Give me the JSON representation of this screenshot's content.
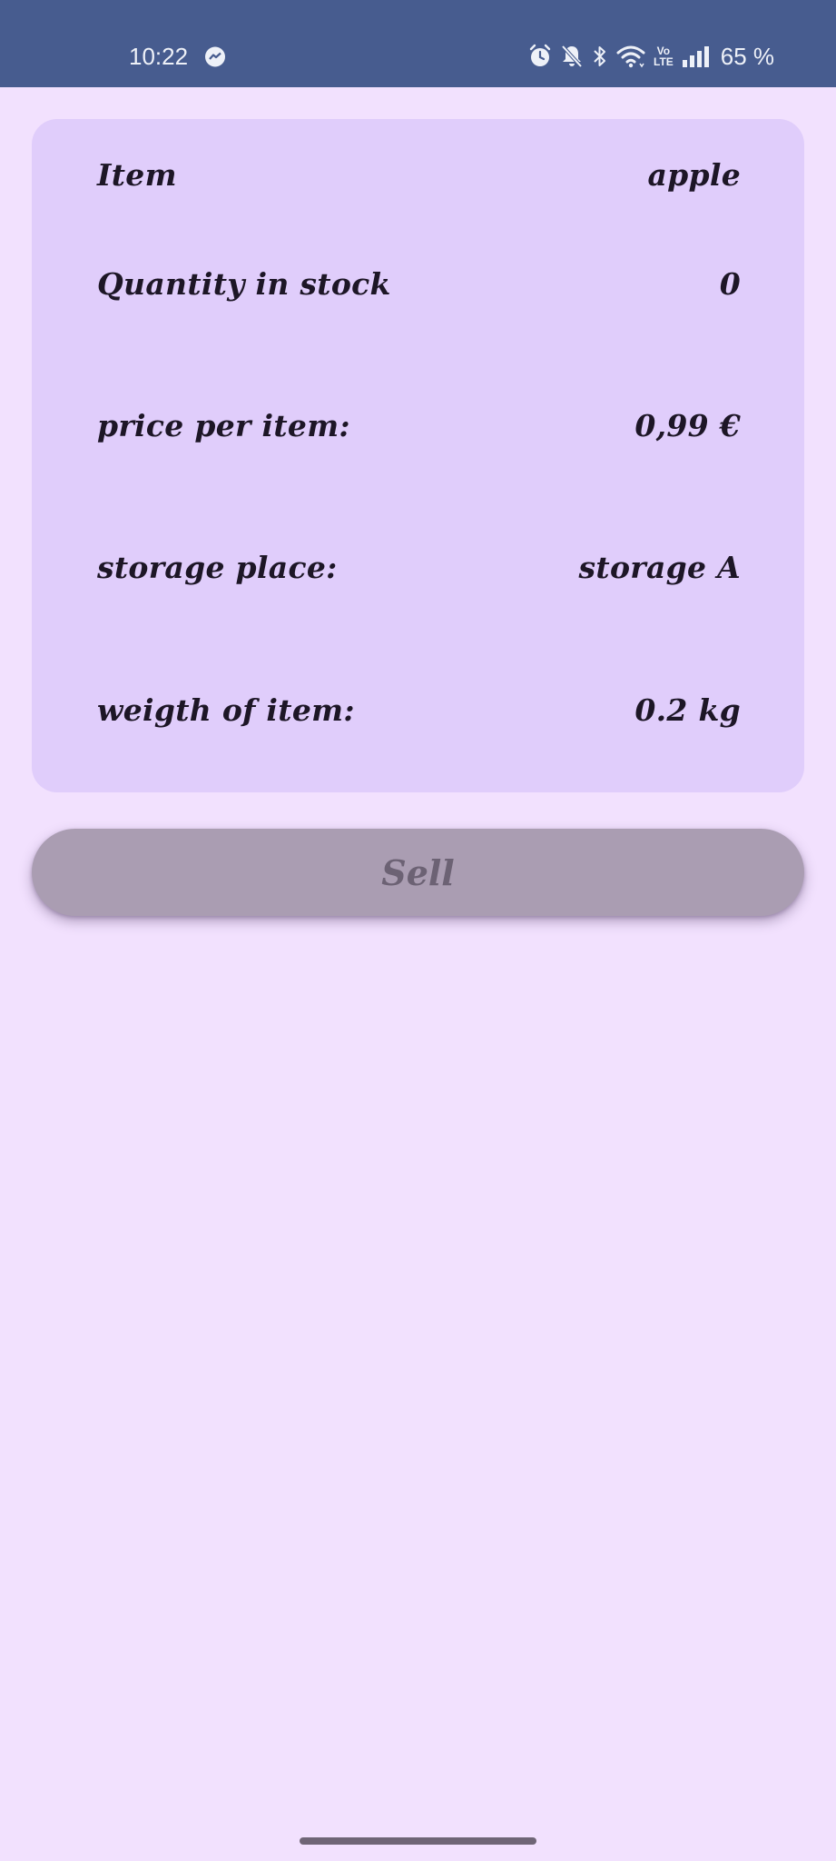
{
  "status_bar": {
    "time": "10:22",
    "left_icons": [
      "messenger-icon"
    ],
    "right_icons": [
      "alarm-icon",
      "bell-off-icon",
      "bluetooth-icon",
      "wifi-icon",
      "volte-icon",
      "signal-icon"
    ],
    "volte_top": "Vo",
    "volte_bottom": "LTE",
    "battery": "65 %"
  },
  "details": {
    "item": {
      "label": "Item",
      "value": "apple"
    },
    "quantity": {
      "label": "Quantity in stock",
      "value": "0"
    },
    "price": {
      "label": "price per item:",
      "value": "0,99 €"
    },
    "storage": {
      "label": "storage place:",
      "value": "storage A"
    },
    "weight": {
      "label": "weigth of item:",
      "value": "0.2 kg"
    }
  },
  "actions": {
    "sell_label": "Sell"
  },
  "colors": {
    "status_bar": "#475c8f",
    "background": "#f2e1fe",
    "card": "#e0cdfb",
    "text": "#1d1626",
    "button_disabled": "#aa9db2",
    "button_text_disabled": "#6c6274"
  }
}
